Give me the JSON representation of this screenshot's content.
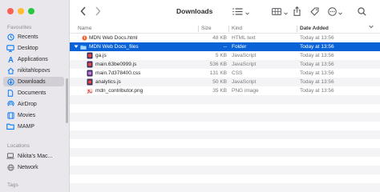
{
  "window": {
    "title": "Downloads"
  },
  "sidebar": {
    "favourites_title": "Favourites",
    "favourites": [
      {
        "label": "Recents",
        "icon": "clock-icon"
      },
      {
        "label": "Desktop",
        "icon": "desktop-icon"
      },
      {
        "label": "Applications",
        "icon": "applications-icon"
      },
      {
        "label": "nikitahlopovs",
        "icon": "home-icon"
      },
      {
        "label": "Downloads",
        "icon": "download-icon",
        "active": true
      },
      {
        "label": "Documents",
        "icon": "document-icon"
      },
      {
        "label": "AirDrop",
        "icon": "airdrop-icon"
      },
      {
        "label": "Movies",
        "icon": "film-icon"
      },
      {
        "label": "MAMP",
        "icon": "folder-icon"
      }
    ],
    "locations_title": "Locations",
    "locations": [
      {
        "label": "Nikita's Mac...",
        "icon": "laptop-icon"
      },
      {
        "label": "Network",
        "icon": "globe-icon"
      }
    ],
    "tags_title": "Tags"
  },
  "columns": {
    "name": "Name",
    "size": "Size",
    "kind": "Kind",
    "date_added": "Date Added"
  },
  "files": [
    {
      "name": "MDN Web Docs.html",
      "size": "48 KB",
      "kind": "HTML text",
      "date": "Today at 13:56",
      "icon": "html-file-icon"
    },
    {
      "name": "MDN Web Docs_files",
      "size": "--",
      "kind": "Folder",
      "date": "Today at 13:56",
      "icon": "folder-icon",
      "selected": true,
      "expanded": true
    },
    {
      "name": "ga.js",
      "size": "5 KB",
      "kind": "JavaScript",
      "date": "Today at 13:56",
      "icon": "js-file-icon"
    },
    {
      "name": "main.63be0999.js",
      "size": "536 KB",
      "kind": "JavaScript",
      "date": "Today at 13:56",
      "icon": "js-file-icon"
    },
    {
      "name": "main.7d378400.css",
      "size": "131 KB",
      "kind": "CSS",
      "date": "Today at 13:56",
      "icon": "css-file-icon"
    },
    {
      "name": "analytics.js",
      "size": "50 KB",
      "kind": "JavaScript",
      "date": "Today at 13:56",
      "icon": "js-file-icon"
    },
    {
      "name": "mdn_contributor.png",
      "size": "35 KB",
      "kind": "PNG image",
      "date": "Today at 13:56",
      "icon": "png-file-icon"
    }
  ],
  "colors": {
    "selection": "#0a63d6",
    "sidebar_bg": "#e9e7ec",
    "folder": "#3d9ef5"
  }
}
